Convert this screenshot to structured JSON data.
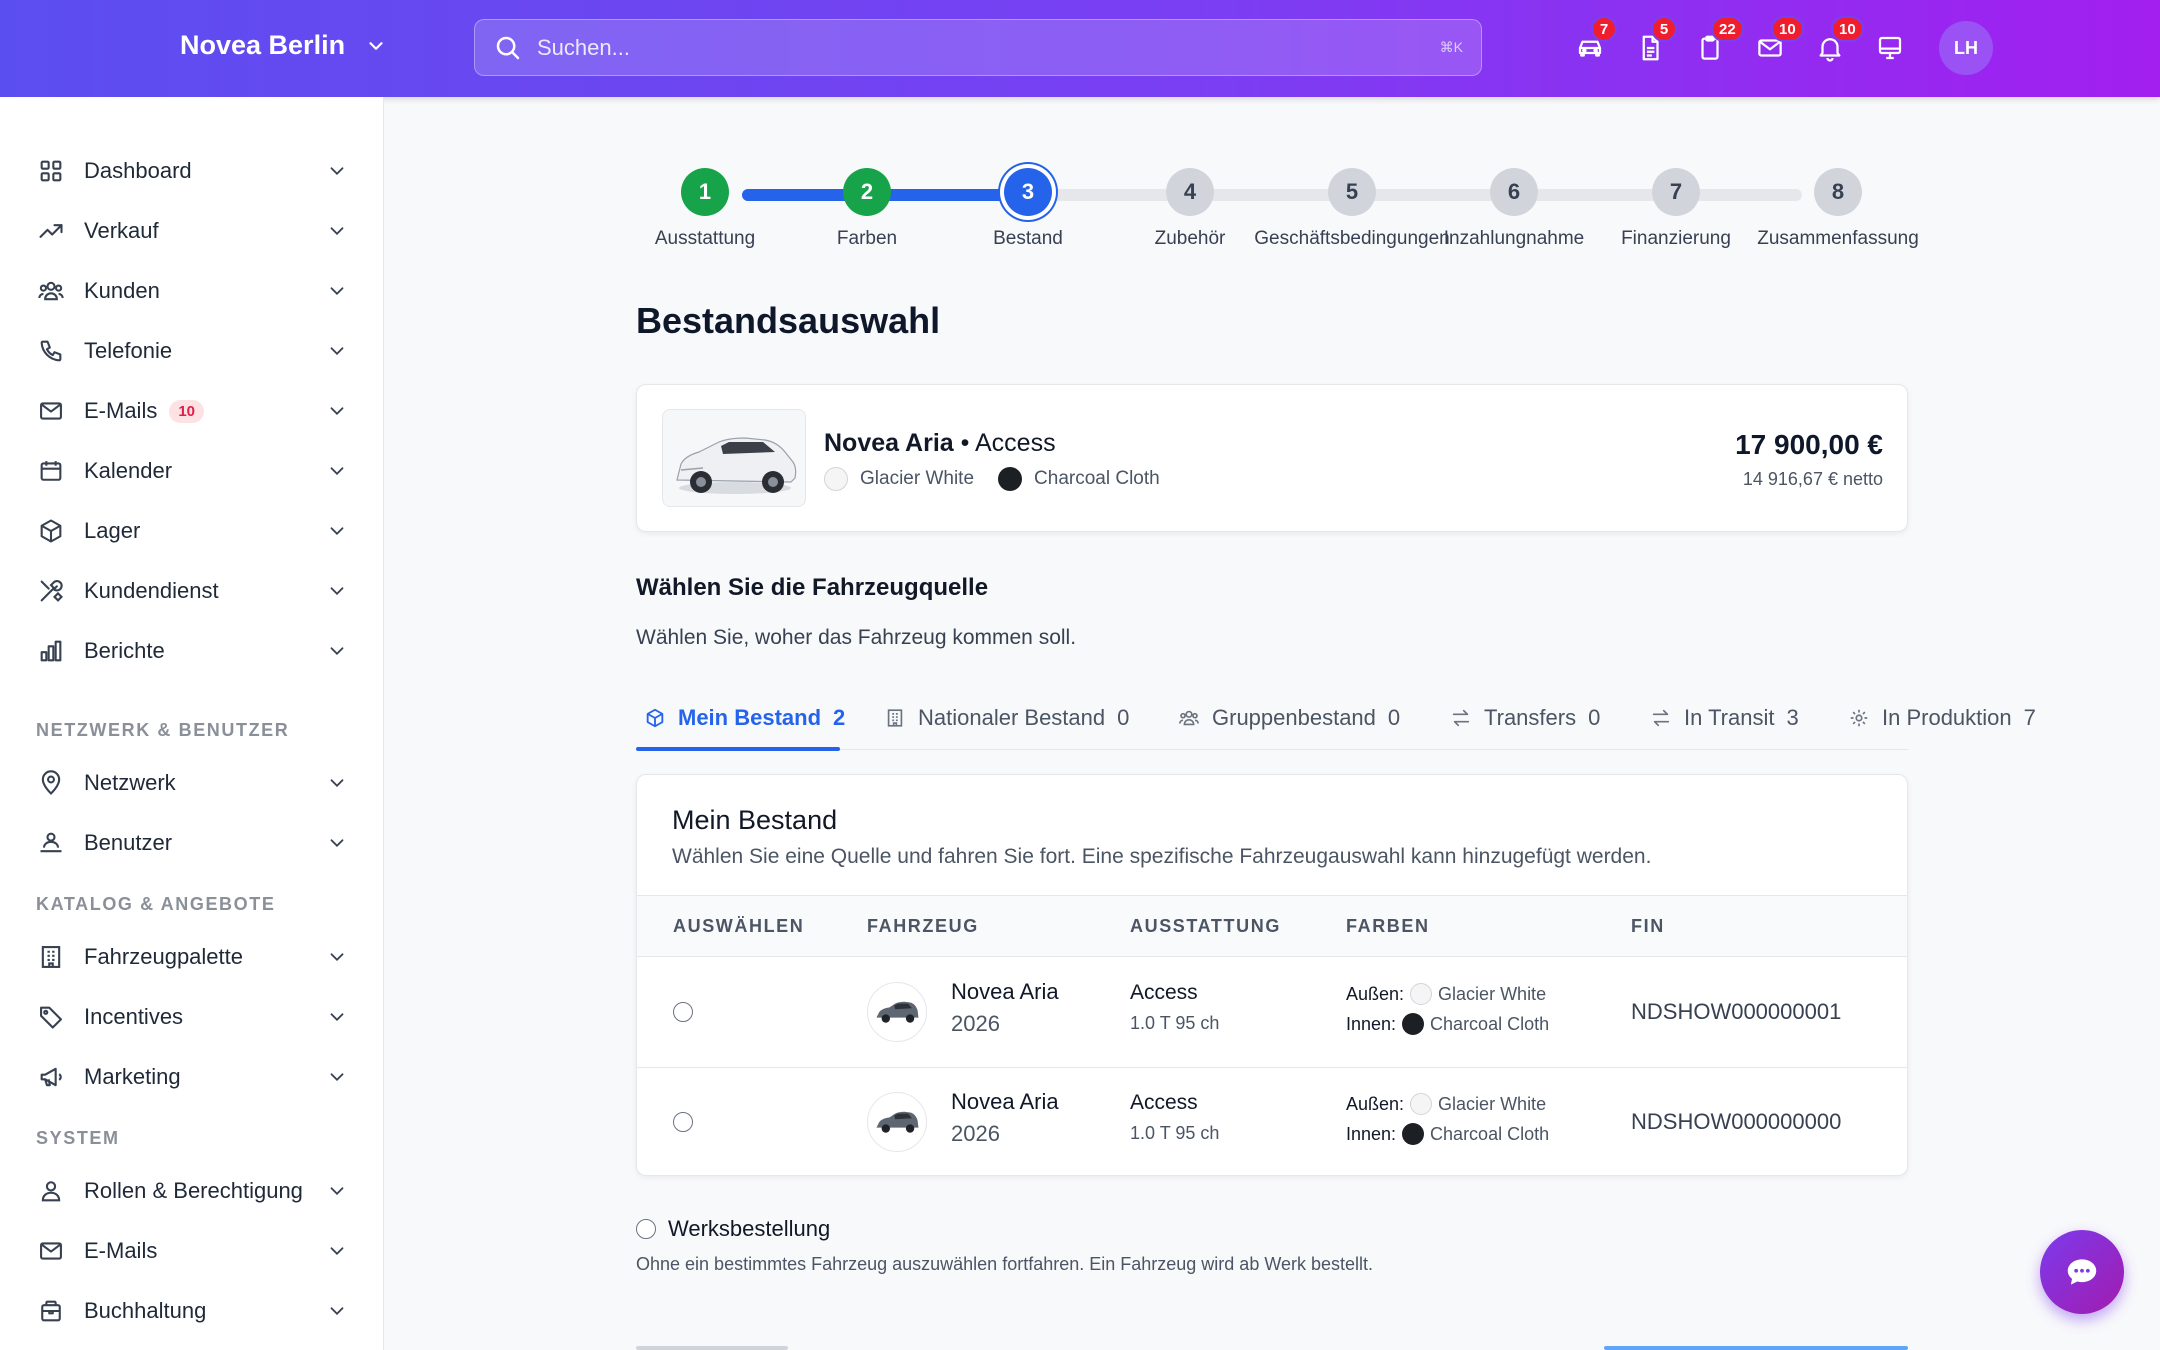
{
  "header": {
    "brand": "Novea Berlin",
    "search_placeholder": "Suchen...",
    "search_shortcut": "⌘K",
    "icons": [
      {
        "name": "car-icon",
        "count": "7"
      },
      {
        "name": "document-icon",
        "count": "5"
      },
      {
        "name": "clipboard-icon",
        "count": "22"
      },
      {
        "name": "mail-icon",
        "count": "10"
      },
      {
        "name": "bell-icon",
        "count": "10"
      },
      {
        "name": "monitor-icon",
        "count": ""
      }
    ],
    "avatar": "LH"
  },
  "sidebar": {
    "main_items": [
      {
        "label": "Dashboard",
        "icon": "grid-icon"
      },
      {
        "label": "Verkauf",
        "icon": "trending-icon"
      },
      {
        "label": "Kunden",
        "icon": "users-icon"
      },
      {
        "label": "Telefonie",
        "icon": "phone-icon"
      },
      {
        "label": "E-Mails",
        "icon": "mail-icon",
        "badge": "10"
      },
      {
        "label": "Kalender",
        "icon": "calendar-icon"
      },
      {
        "label": "Lager",
        "icon": "box-icon"
      },
      {
        "label": "Kundendienst",
        "icon": "tools-icon"
      },
      {
        "label": "Berichte",
        "icon": "bar-chart-icon"
      }
    ],
    "section_network": "NETZWERK & BENUTZER",
    "network_items": [
      {
        "label": "Netzwerk",
        "icon": "location-icon"
      },
      {
        "label": "Benutzer",
        "icon": "user-desk-icon"
      }
    ],
    "section_catalog": "KATALOG & ANGEBOTE",
    "catalog_items": [
      {
        "label": "Fahrzeugpalette",
        "icon": "building-icon"
      },
      {
        "label": "Incentives",
        "icon": "tag-icon"
      },
      {
        "label": "Marketing",
        "icon": "megaphone-icon"
      }
    ],
    "section_system": "SYSTEM",
    "system_items": [
      {
        "label": "Rollen & Berechtigung",
        "icon": "user-icon"
      },
      {
        "label": "E-Mails",
        "icon": "mail-icon"
      },
      {
        "label": "Buchhaltung",
        "icon": "wallet-icon"
      }
    ]
  },
  "stepper": {
    "current": 3,
    "steps": [
      {
        "number": "1",
        "label": "Ausstattung",
        "state": "done"
      },
      {
        "number": "2",
        "label": "Farben",
        "state": "done"
      },
      {
        "number": "3",
        "label": "Bestand",
        "state": "current"
      },
      {
        "number": "4",
        "label": "Zubehör",
        "state": "todo"
      },
      {
        "number": "5",
        "label": "Geschäftsbedingungen",
        "state": "todo"
      },
      {
        "number": "6",
        "label": "Inzahlungnahme",
        "state": "todo"
      },
      {
        "number": "7",
        "label": "Finanzierung",
        "state": "todo"
      },
      {
        "number": "8",
        "label": "Zusammenfassung",
        "state": "todo"
      }
    ]
  },
  "main": {
    "title": "Bestandsauswahl",
    "summary": {
      "model": "Novea Aria",
      "separator": "•",
      "trim": "Access",
      "exterior": "Glacier White",
      "interior": "Charcoal Cloth",
      "price": "17 900,00 €",
      "netto": "14 916,67 € netto"
    },
    "source_title": "Wählen Sie die Fahrzeugquelle",
    "source_subtitle": "Wählen Sie, woher das Fahrzeug kommen soll.",
    "tabs": [
      {
        "label": "Mein Bestand",
        "count": "2",
        "icon": "cube-icon",
        "active": true
      },
      {
        "label": "Nationaler Bestand",
        "count": "0",
        "icon": "building-icon"
      },
      {
        "label": "Gruppenbestand",
        "count": "0",
        "icon": "users-icon"
      },
      {
        "label": "Transfers",
        "count": "0",
        "icon": "arrows-icon"
      },
      {
        "label": "In Transit",
        "count": "3",
        "icon": "arrows-icon"
      },
      {
        "label": "In Produktion",
        "count": "7",
        "icon": "gear-icon"
      }
    ],
    "table": {
      "title": "Mein Bestand",
      "subtitle": "Wählen Sie eine Quelle und fahren Sie fort. Eine spezifische Fahrzeugauswahl kann hinzugefügt werden.",
      "columns": [
        "AUSWÄHLEN",
        "FAHRZEUG",
        "AUSSTATTUNG",
        "FARBEN",
        "FIN"
      ],
      "rows": [
        {
          "model": "Novea Aria",
          "year": "2026",
          "trim": "Access",
          "engine": "1.0 T 95 ch",
          "ext_label": "Außen:",
          "ext": "Glacier White",
          "int_label": "Innen:",
          "int": "Charcoal Cloth",
          "vin": "NDSHOW000000001"
        },
        {
          "model": "Novea Aria",
          "year": "2026",
          "trim": "Access",
          "engine": "1.0 T 95 ch",
          "ext_label": "Außen:",
          "ext": "Glacier White",
          "int_label": "Innen:",
          "int": "Charcoal Cloth",
          "vin": "NDSHOW000000000"
        }
      ]
    },
    "werk_label": "Werksbestellung",
    "werk_sub": "Ohne ein bestimmtes Fahrzeug auszuwählen fortfahren. Ein Fahrzeug wird ab Werk bestellt."
  },
  "colors": {
    "accent": "#2563eb",
    "done": "#16a34a",
    "todo": "#e5e7eb",
    "header_from": "#5b4ef0",
    "header_to": "#a21ff0"
  }
}
